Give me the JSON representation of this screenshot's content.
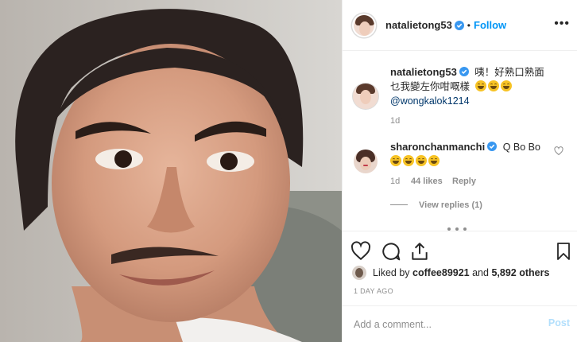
{
  "header": {
    "username": "natalietong53",
    "separator": "•",
    "follow_label": "Follow",
    "more_label": "•••"
  },
  "caption": {
    "username": "natalietong53",
    "line1": "咦！好熟口熟面",
    "line2": "乜我變左你咁嘅樣",
    "mention": "@wongkalok1214",
    "time": "1d"
  },
  "comment": {
    "username": "sharonchanmanchi",
    "text": "Q Bo Bo",
    "time": "1d",
    "likes": "44 likes",
    "reply_label": "Reply",
    "view_replies": "View replies (1)"
  },
  "actions": {
    "liked_by_prefix": "Liked by",
    "liked_by_user": "coffee89921",
    "liked_by_and": "and",
    "others": "5,892 others"
  },
  "post_date": "1 DAY AGO",
  "comment_box": {
    "placeholder": "Add a comment...",
    "post_label": "Post"
  },
  "colors": {
    "accent": "#0095f6",
    "muted": "#8e8e8e",
    "border": "#efefef",
    "post_disabled": "#b2dffc"
  }
}
